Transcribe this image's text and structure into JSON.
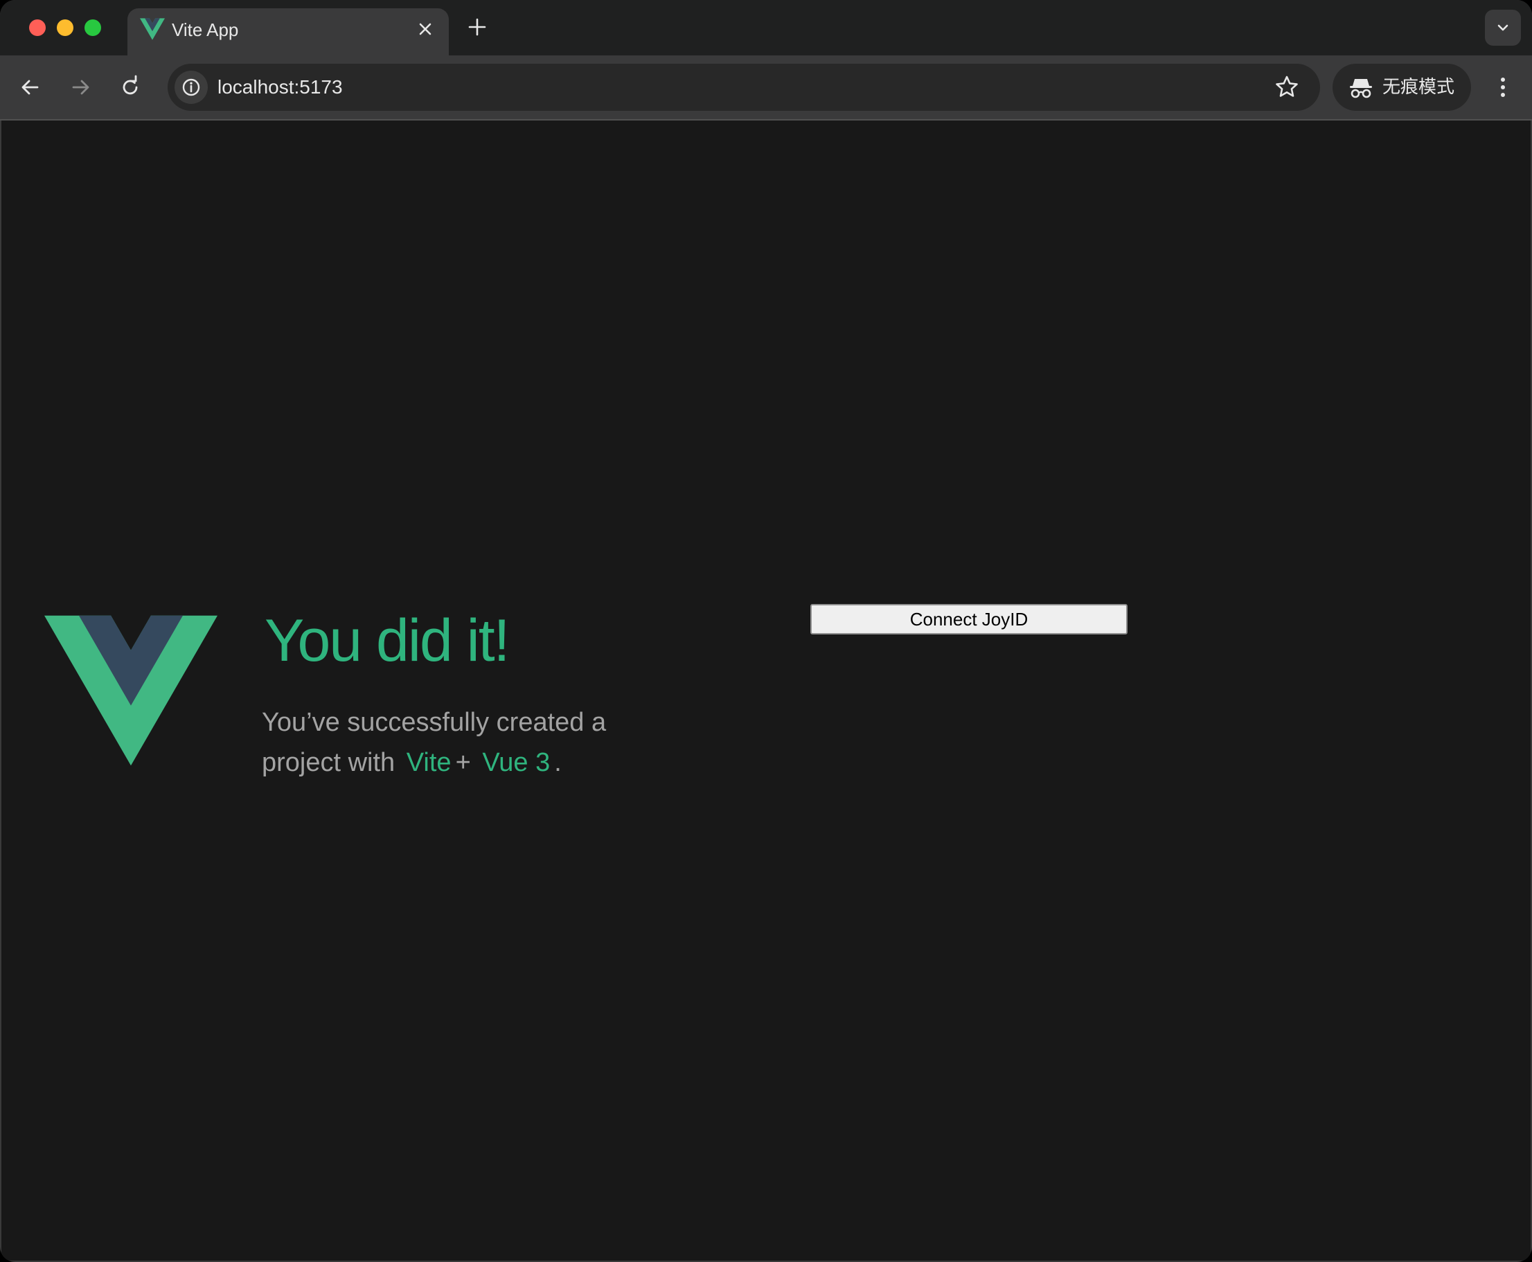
{
  "browser": {
    "tab": {
      "title": "Vite App",
      "favicon": "vue-logo-icon"
    },
    "address_bar": {
      "url": "localhost:5173"
    },
    "incognito": {
      "label": "无痕模式"
    },
    "colors": {
      "tab_bar": "#1f2020",
      "toolbar": "#3a3a3b",
      "omnibox": "#282828",
      "page_background": "#181818"
    }
  },
  "page": {
    "heading": "You did it!",
    "message": {
      "prefix": "You’ve successfully created a project with",
      "link_vite": "Vite",
      "plus": "+",
      "link_vue": "Vue 3",
      "suffix": "."
    },
    "button": {
      "connect_label": "Connect JoyID"
    },
    "colors": {
      "accent_green": "#2fb47e",
      "logo_green": "#41b883",
      "logo_dark": "#35495e",
      "body_text": "#a3a3a3"
    }
  }
}
